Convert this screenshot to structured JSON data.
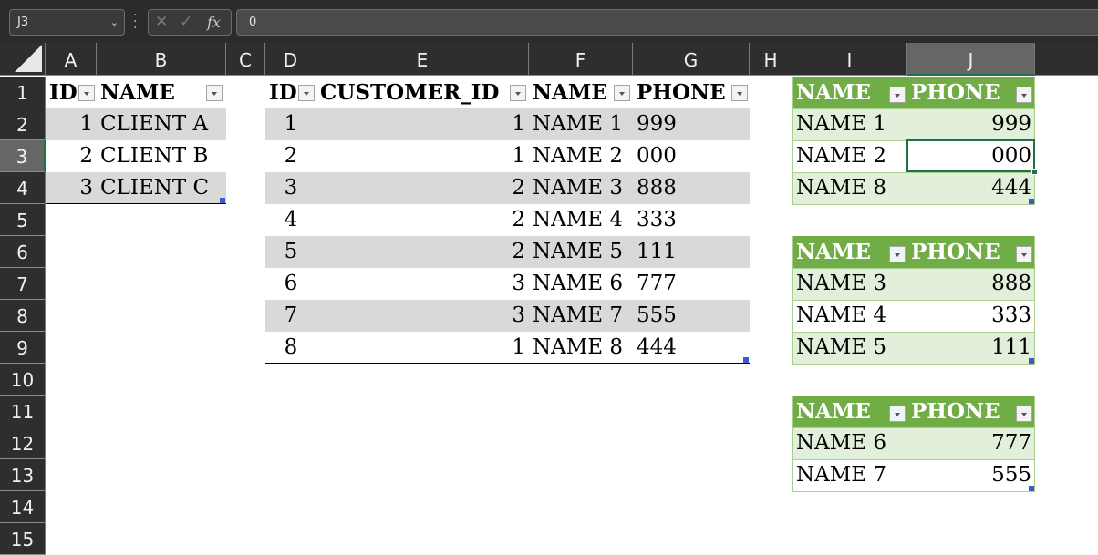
{
  "formula_bar": {
    "name_box": "J3",
    "cancel_icon": "✕",
    "enter_icon": "✓",
    "fx_label": "fx",
    "formula_value": "0"
  },
  "columns": [
    "A",
    "B",
    "C",
    "D",
    "E",
    "F",
    "G",
    "H",
    "I",
    "J"
  ],
  "rows": [
    "1",
    "2",
    "3",
    "4",
    "5",
    "6",
    "7",
    "8",
    "9",
    "10",
    "11",
    "12",
    "13",
    "14",
    "15"
  ],
  "selected_cell": "J3",
  "table_clients": {
    "headers": [
      "ID",
      "NAME"
    ],
    "rows": [
      {
        "id": "1",
        "name": "CLIENT A"
      },
      {
        "id": "2",
        "name": "CLIENT B"
      },
      {
        "id": "3",
        "name": "CLIENT C"
      }
    ]
  },
  "table_contacts": {
    "headers": [
      "ID",
      "CUSTOMER_ID",
      "NAME",
      "PHONE"
    ],
    "rows": [
      {
        "id": "1",
        "customer_id": "1",
        "name": "NAME 1",
        "phone": "999"
      },
      {
        "id": "2",
        "customer_id": "1",
        "name": "NAME 2",
        "phone": "000"
      },
      {
        "id": "3",
        "customer_id": "2",
        "name": "NAME 3",
        "phone": "888"
      },
      {
        "id": "4",
        "customer_id": "2",
        "name": "NAME 4",
        "phone": "333"
      },
      {
        "id": "5",
        "customer_id": "2",
        "name": "NAME 5",
        "phone": "111"
      },
      {
        "id": "6",
        "customer_id": "3",
        "name": "NAME 6",
        "phone": "777"
      },
      {
        "id": "7",
        "customer_id": "3",
        "name": "NAME 7",
        "phone": "555"
      },
      {
        "id": "8",
        "customer_id": "1",
        "name": "NAME 8",
        "phone": "444"
      }
    ]
  },
  "result_tables": [
    {
      "headers": [
        "NAME",
        "PHONE"
      ],
      "rows": [
        {
          "name": "NAME 1",
          "phone": "999"
        },
        {
          "name": "NAME 2",
          "phone": "000"
        },
        {
          "name": "NAME 8",
          "phone": "444"
        }
      ]
    },
    {
      "headers": [
        "NAME",
        "PHONE"
      ],
      "rows": [
        {
          "name": "NAME 3",
          "phone": "888"
        },
        {
          "name": "NAME 4",
          "phone": "333"
        },
        {
          "name": "NAME 5",
          "phone": "111"
        }
      ]
    },
    {
      "headers": [
        "NAME",
        "PHONE"
      ],
      "rows": [
        {
          "name": "NAME 6",
          "phone": "777"
        },
        {
          "name": "NAME 7",
          "phone": "555"
        }
      ]
    }
  ],
  "colors": {
    "table_header_green": "#70ad47",
    "table_band_green": "#e2efda",
    "table_band_grey": "#d9d9d9",
    "selection_green": "#217346"
  }
}
